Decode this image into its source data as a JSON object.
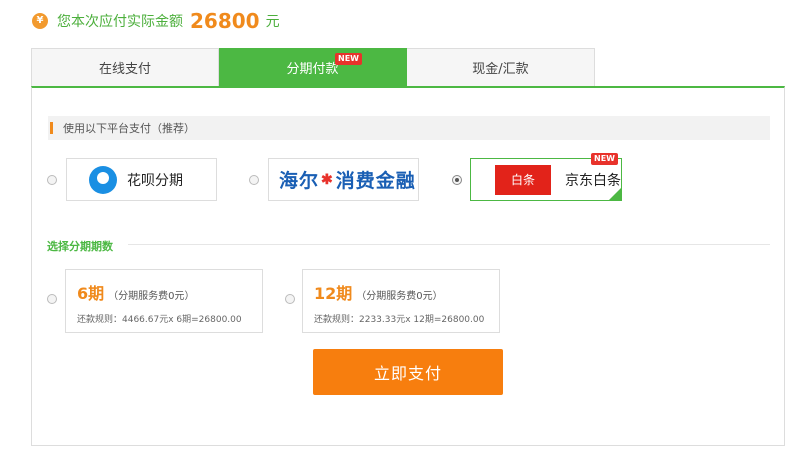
{
  "header": {
    "icon_symbol": "¥",
    "label": "您本次应付实际金额",
    "amount": "26800",
    "unit": "元"
  },
  "tabs": [
    {
      "label": "在线支付",
      "active": false
    },
    {
      "label": "分期付款",
      "active": true,
      "badge": "NEW"
    },
    {
      "label": "现金/汇款",
      "active": false
    }
  ],
  "platform_section": {
    "title": "使用以下平台支付（推荐）"
  },
  "platforms": [
    {
      "name": "花呗分期",
      "icon": "huabei-icon",
      "selected": false
    },
    {
      "name": "海尔消费金融",
      "logo_text_a": "海尔",
      "logo_text_b": "消费金融",
      "icon": "haier-logo",
      "selected": false
    },
    {
      "name": "京东白条",
      "logo_text": "白条",
      "icon": "jd-baitiao-logo",
      "selected": true,
      "badge": "NEW"
    }
  ],
  "installment_section": {
    "title": "选择分期期数"
  },
  "installments": [
    {
      "term": "6期",
      "fee": "（分期服务费0元）",
      "rule": "还款规则：4466.67元x 6期=26800.00",
      "selected": false
    },
    {
      "term": "12期",
      "fee": "（分期服务费0元）",
      "rule": "还款规则：2233.33元x 12期=26800.00",
      "selected": false
    }
  ],
  "pay_button": {
    "label": "立即支付"
  },
  "colors": {
    "green": "#4cb843",
    "orange": "#f77e0e",
    "amount_orange": "#f08a1c",
    "jd_red": "#e2231a",
    "badge_red": "#e8322b"
  }
}
